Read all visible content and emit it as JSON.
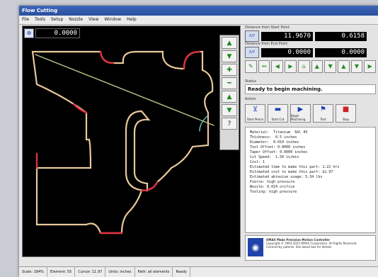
{
  "window": {
    "title": "Flow Cutting"
  },
  "menu": [
    "File",
    "Tools",
    "Setup",
    "Nozzle",
    "View",
    "Window",
    "Help"
  ],
  "canvas": {
    "readout_value": "0.0000"
  },
  "palette": [
    "arrow-up-icon",
    "arrow-down-icon",
    "plus-icon",
    "minus-icon",
    "arrow-up-icon",
    "arrow-down-icon",
    "help-icon"
  ],
  "dro": {
    "caption_1": "Distance from Start Point",
    "row1": {
      "axis": "X/Y",
      "x": "11.9670",
      "y": "0.6158"
    },
    "caption_2": "Distance from End Point",
    "row2": {
      "axis": "X/Y",
      "x": "0.0000",
      "y": "0.0000"
    }
  },
  "status": {
    "label": "Status",
    "text": "Ready to begin machining."
  },
  "actions_label": "Action",
  "actions": [
    "Start Pierce",
    "Start Cut",
    "Begin Machining",
    "Test",
    "Stop"
  ],
  "info_lines": [
    "Material:  Titanium  6Al 4V",
    "Thickness:  0.5 inches",
    "Diameter:  0.010 inches",
    "Tool Offset: 0.0000 inches",
    "Taper Offset: 0.0000 inches",
    "Cut Speed:  1.50 in/min",
    "Cost: 1",
    "",
    "Estimated time to make this part: 1:22 hrs",
    "Estimated cost to make this part: $1.97",
    "Estimated abrasive usage: 5.34 lbs",
    "",
    "Pierce: high pressure",
    "Nozzle: 0.014 orifice",
    "Tooling: high pressure"
  ],
  "about": {
    "title": "OMAX Make Precision Motion Controller",
    "line2": "Copyright © 1993-2015 OMAX Corporation. All Rights Reserved.",
    "line3": "Covered by patents. See about box for details."
  },
  "statusbar": [
    "Scale: 184%",
    "Element: 55",
    "Cursor: 11.97",
    "Units: inches",
    "Path: all elements",
    "Ready"
  ]
}
